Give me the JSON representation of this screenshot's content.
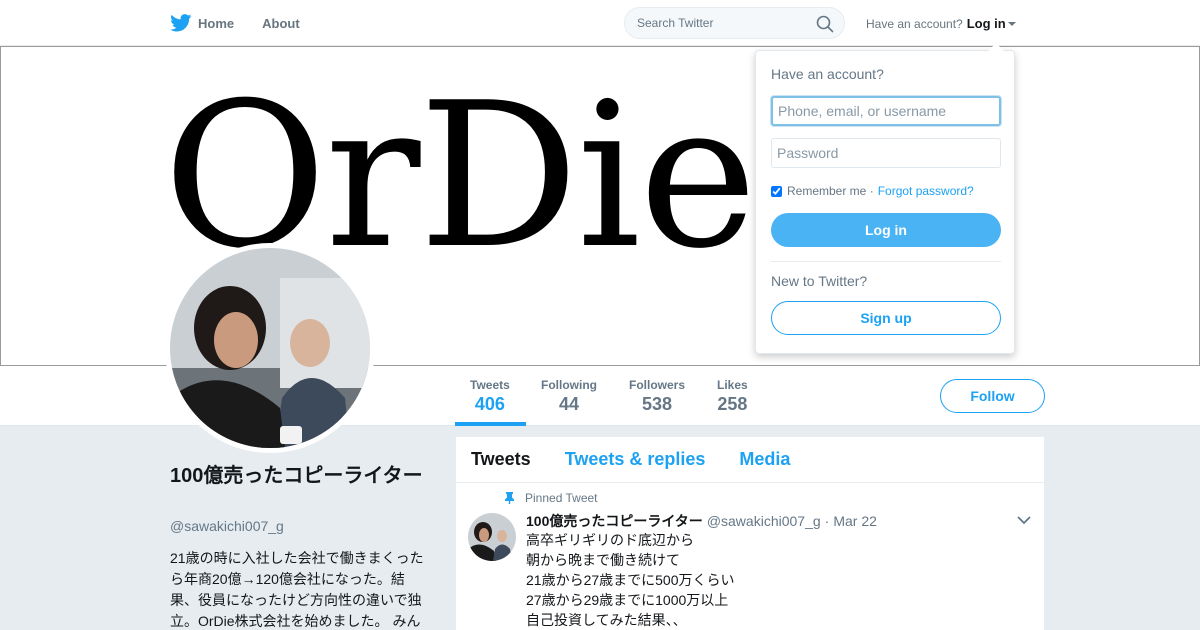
{
  "nav": {
    "home_label": "Home",
    "about_label": "About",
    "search_placeholder": "Search Twitter",
    "have_account": "Have an account?",
    "login_label": "Log in"
  },
  "banner": {
    "text": "OrDie,.."
  },
  "stats": [
    {
      "label": "Tweets",
      "value": "406"
    },
    {
      "label": "Following",
      "value": "44"
    },
    {
      "label": "Followers",
      "value": "538"
    },
    {
      "label": "Likes",
      "value": "258"
    }
  ],
  "follow_label": "Follow",
  "profile": {
    "name": "100億売ったコピーライター",
    "handle": "@sawakichi007_g",
    "bio": "21歳の時に入社した会社で働きまくったら年商20億→120億会社になった。結果、役員になったけど方向性の違いで独立。OrDie株式会社を始めました。 みん"
  },
  "timeline": {
    "tabs": [
      "Tweets",
      "Tweets & replies",
      "Media"
    ],
    "pinned_label": "Pinned Tweet",
    "tweet": {
      "author": "100億売ったコピーライター",
      "handle": "@sawakichi007_g",
      "separator": "·",
      "time": "Mar 22",
      "lines": [
        "高卒ギリギリのド底辺から",
        "朝から晩まで働き続けて",
        "21歳から27歳までに500万くらい",
        "27歳から29歳までに1000万以上",
        "自己投資してみた結果、、"
      ]
    }
  },
  "login_dropdown": {
    "title": "Have an account?",
    "username_placeholder": "Phone, email, or username",
    "password_placeholder": "Password",
    "remember_label": "Remember me ·",
    "forgot_label": "Forgot password?",
    "login_button": "Log in",
    "new_label": "New to Twitter?",
    "signup_button": "Sign up"
  },
  "colors": {
    "brand": "#1da1f2",
    "login_button": "#4ab3f4"
  }
}
